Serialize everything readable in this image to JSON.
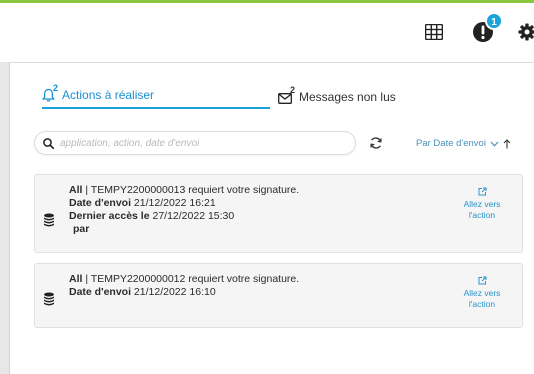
{
  "header": {
    "alert_badge": "1",
    "icons": [
      "grid-icon",
      "alert-icon",
      "gear-icon"
    ],
    "accent_color": "#8cc63f"
  },
  "tabs": [
    {
      "label": "Actions à réaliser",
      "count": "2",
      "icon": "bell-icon",
      "active": true
    },
    {
      "label": "Messages non lus",
      "count": "2",
      "icon": "envelope-icon",
      "active": false
    }
  ],
  "search": {
    "placeholder": "application, action, date d'envoi",
    "value": ""
  },
  "sort": {
    "label": "Par Date d'envoi"
  },
  "actions": [
    {
      "scope": "All",
      "text": " | TEMPY2200000013 requiert votre signature.",
      "date_label": "Date d'envoi",
      "date_value": " 21/12/2022 16:21",
      "access_label": "Dernier accès le",
      "access_value": " 27/12/2022 15:30",
      "by_label": "par",
      "goto_label": "Allez vers l'action"
    },
    {
      "scope": "All",
      "text": " | TEMPY2200000012 requiert votre signature.",
      "date_label": "Date d'envoi",
      "date_value": " 21/12/2022 16:10",
      "goto_label": "Allez vers l'action"
    }
  ],
  "colors": {
    "link": "#1a8fcf",
    "badge": "#1aa3d9",
    "card_bg": "#f5f5f5"
  }
}
